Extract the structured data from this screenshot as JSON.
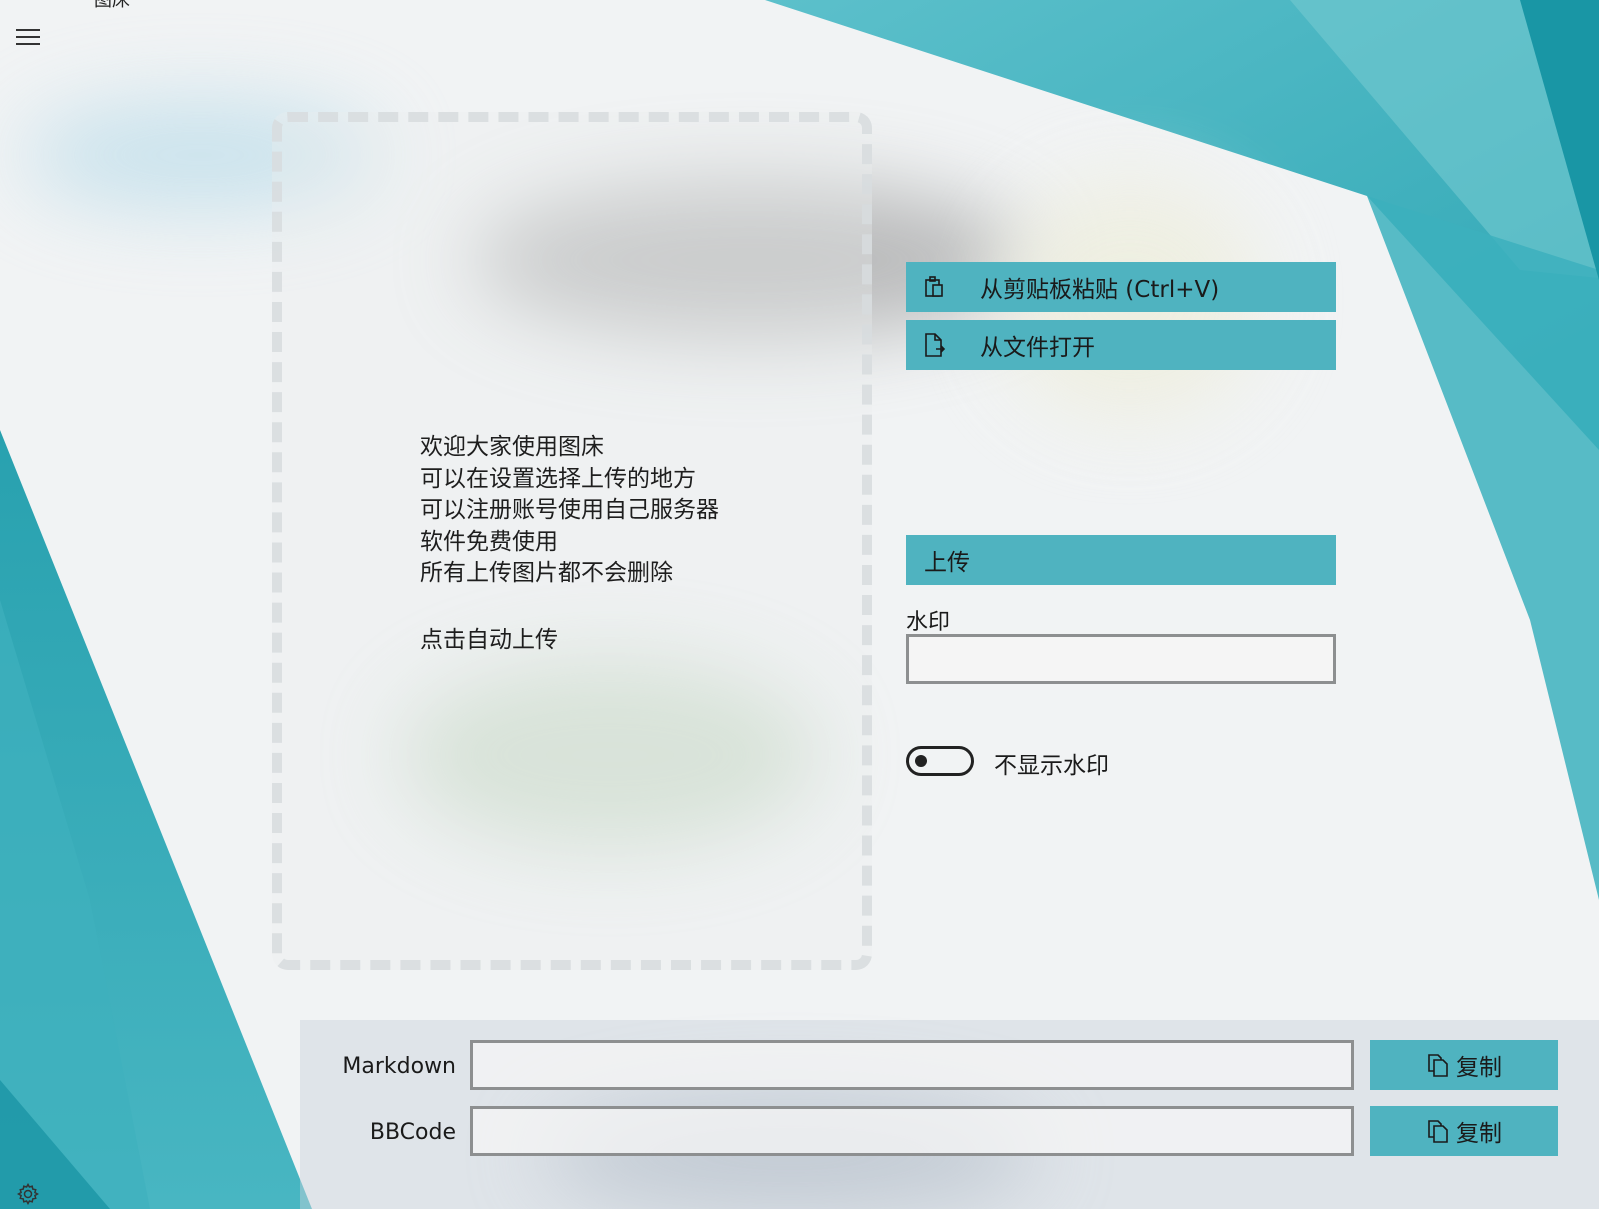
{
  "window": {
    "title": "图床"
  },
  "drop_zone": {
    "intro_lines": [
      "欢迎大家使用图床",
      "可以在设置选择上传的地方",
      "可以注册账号使用自己服务器",
      "软件免费使用",
      "所有上传图片都不会删除"
    ],
    "auto_upload_text": "点击自动上传"
  },
  "actions": {
    "paste_label": "从剪贴板粘贴 (Ctrl+V)",
    "paste_icon": "clipboard-icon",
    "open_file_label": "从文件打开",
    "open_file_icon": "open-file-icon",
    "upload_label": "上传"
  },
  "watermark": {
    "label": "水印",
    "value": "",
    "toggle_label": "不显示水印",
    "toggle_on": false
  },
  "outputs": {
    "markdown_label": "Markdown",
    "markdown_value": "",
    "bbcode_label": "BBCode",
    "bbcode_value": "",
    "copy_label": "复制",
    "copy_icon": "copy-icon"
  },
  "colors": {
    "accent": "#4fb3c0",
    "teal_dark": "#1e9aa8",
    "teal_light": "#6fc4cd",
    "input_border": "#8d8f90"
  }
}
